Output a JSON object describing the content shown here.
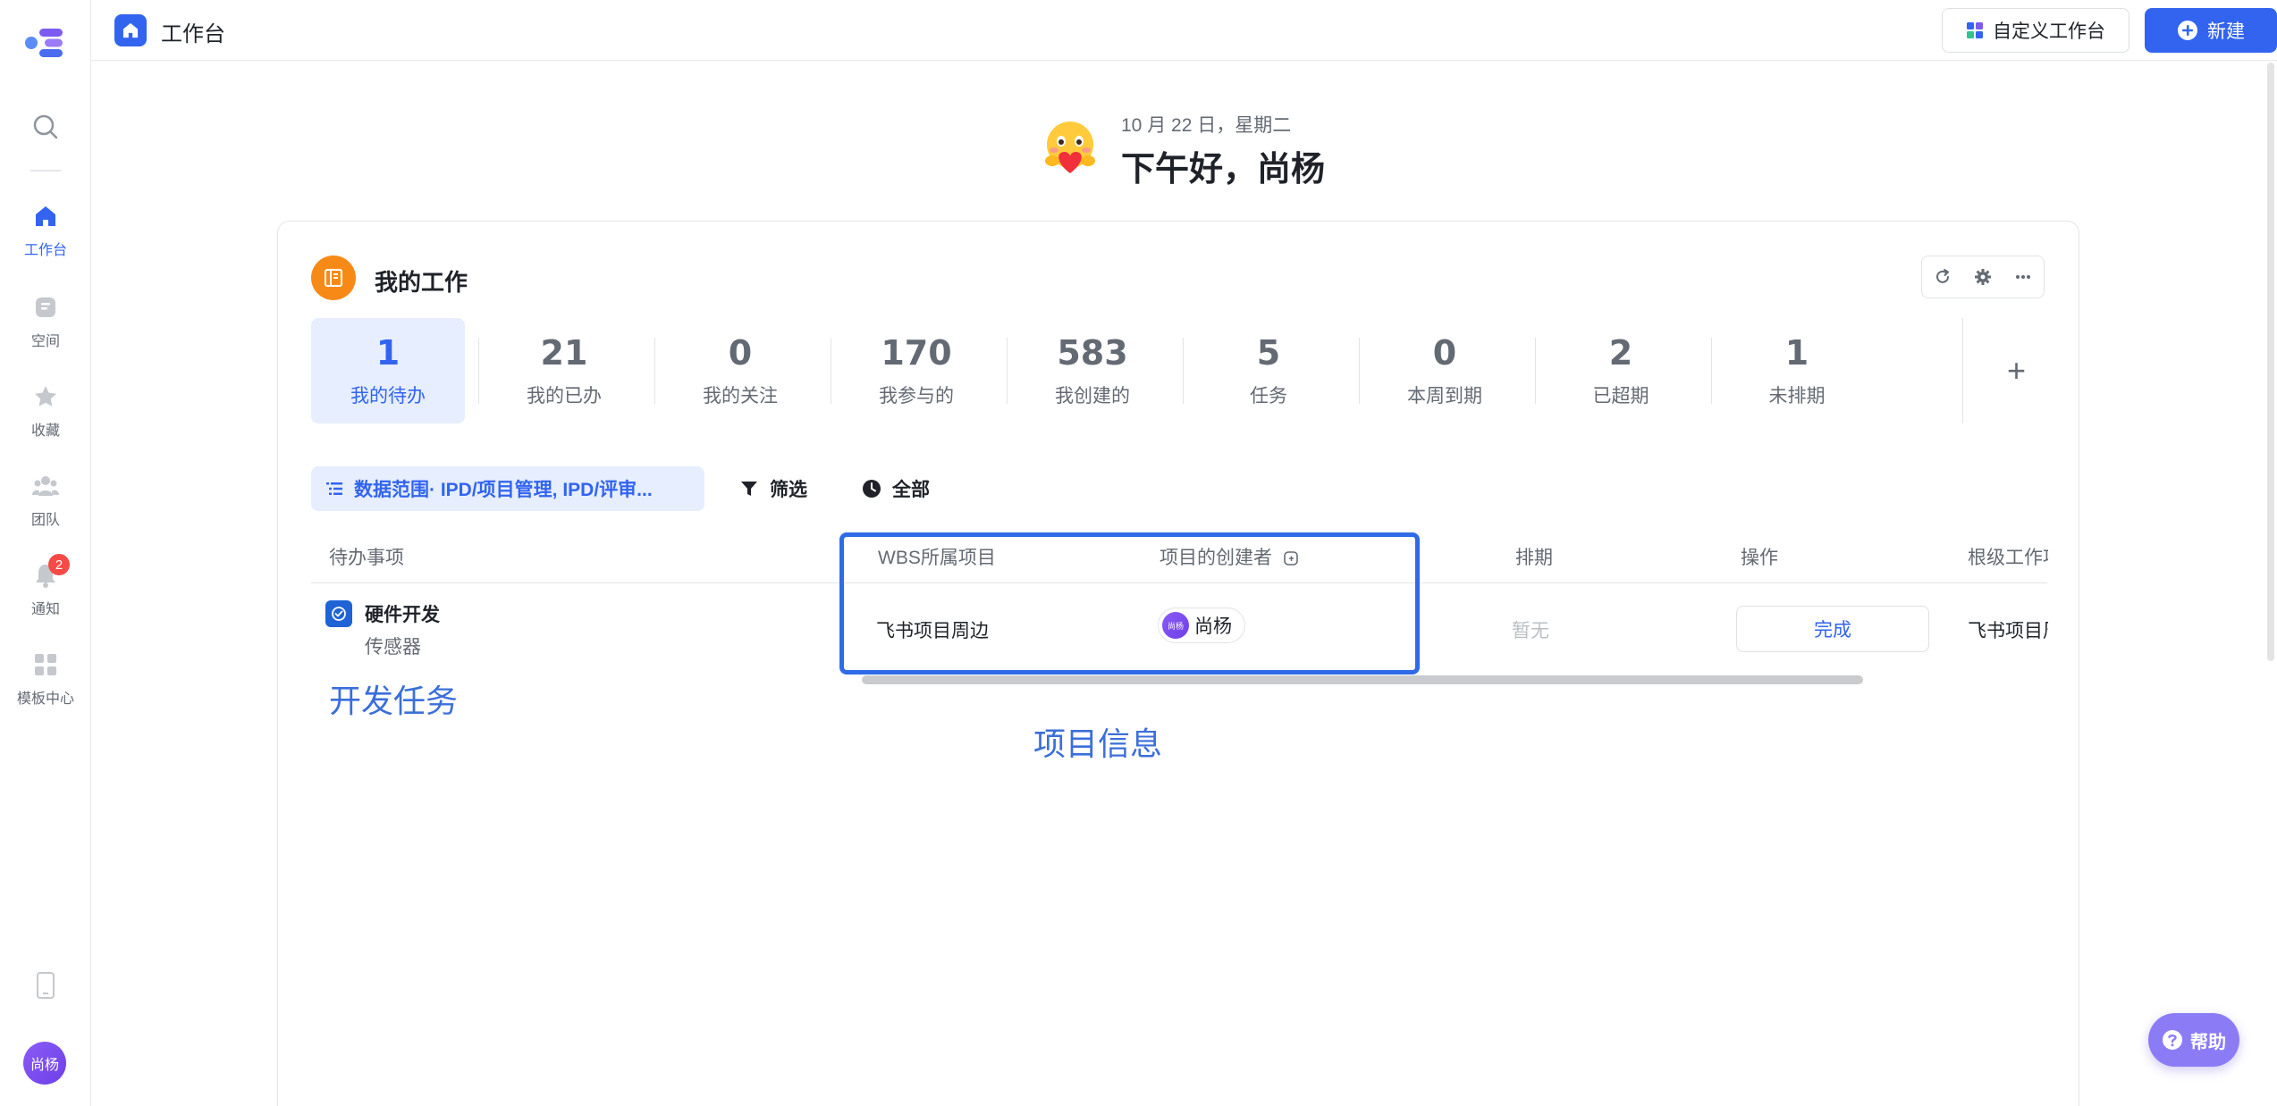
{
  "sidebar": {
    "items": [
      {
        "label": "工作台",
        "icon": "home-icon",
        "active": true
      },
      {
        "label": "空间",
        "icon": "space-icon"
      },
      {
        "label": "收藏",
        "icon": "star-icon"
      },
      {
        "label": "团队",
        "icon": "team-icon"
      },
      {
        "label": "通知",
        "icon": "bell-icon",
        "badge": "2"
      },
      {
        "label": "模板中心",
        "icon": "template-icon"
      }
    ],
    "avatar_text": "尚杨"
  },
  "topbar": {
    "title": "工作台",
    "custom_button": "自定义工作台",
    "new_button": "新建"
  },
  "greeting": {
    "date": "10 月 22 日，星期二",
    "text": "下午好，尚杨"
  },
  "card": {
    "title": "我的工作",
    "stats": [
      {
        "value": "1",
        "label": "我的待办",
        "active": true
      },
      {
        "value": "21",
        "label": "我的已办"
      },
      {
        "value": "0",
        "label": "我的关注"
      },
      {
        "value": "170",
        "label": "我参与的"
      },
      {
        "value": "583",
        "label": "我创建的"
      },
      {
        "value": "5",
        "label": "任务"
      },
      {
        "value": "0",
        "label": "本周到期"
      },
      {
        "value": "2",
        "label": "已超期"
      },
      {
        "value": "1",
        "label": "未排期"
      }
    ],
    "add_symbol": "+",
    "filters": {
      "range": "数据范围· IPD/项目管理, IPD/评审...",
      "filter": "筛选",
      "all": "全部"
    },
    "table": {
      "headers": {
        "todo": "待办事项",
        "wbs_project": "WBS所属项目",
        "creator": "项目的创建者",
        "schedule": "排期",
        "action": "操作",
        "root": "根级工作项"
      },
      "row": {
        "name": "硬件开发",
        "sub": "传感器",
        "wbs_project": "飞书项目周边",
        "creator": "尚杨",
        "creator_avatar": "尚杨",
        "schedule": "暂无",
        "action": "完成",
        "root": "飞书项目周"
      }
    }
  },
  "annotations": {
    "dev_task": "开发任务",
    "project_info": "项目信息"
  },
  "help": "帮助",
  "colors": {
    "accent": "#3264f0",
    "annotation": "#2f6be8",
    "card_icon": "#f78a17",
    "badge": "#f54a45"
  }
}
